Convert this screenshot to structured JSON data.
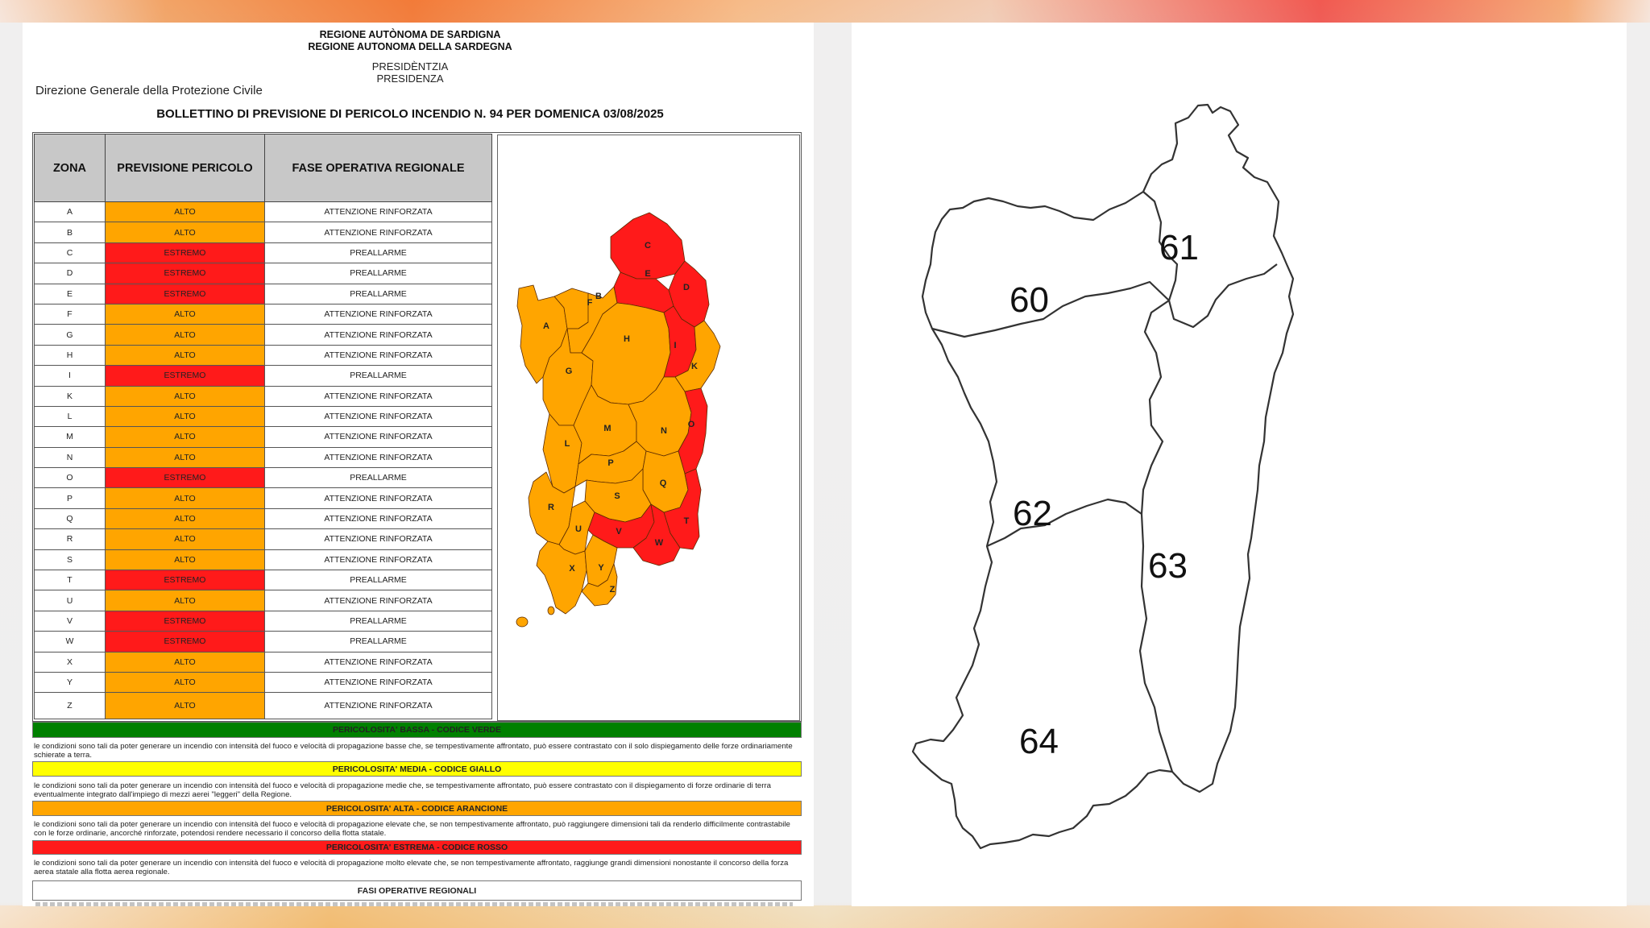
{
  "header": {
    "region_sardinian": "REGIONE AUTÒNOMA DE SARDIGNA",
    "region_italian": "REGIONE AUTONOMA DELLA SARDEGNA",
    "presidency_sardinian": "PRESIDÈNTZIA",
    "presidency_italian": "PRESIDENZA",
    "direction": "Direzione Generale della Protezione Civile",
    "title": "BOLLETTINO DI PREVISIONE DI PERICOLO INCENDIO N. 94 PER DOMENICA 03/08/2025"
  },
  "table": {
    "headers": [
      "ZONA",
      "PREVISIONE PERICOLO",
      "FASE OPERATIVA REGIONALE"
    ],
    "rows": [
      {
        "zona": "A",
        "pericolo": "ALTO",
        "fase": "ATTENZIONE RINFORZATA"
      },
      {
        "zona": "B",
        "pericolo": "ALTO",
        "fase": "ATTENZIONE RINFORZATA"
      },
      {
        "zona": "C",
        "pericolo": "ESTREMO",
        "fase": "PREALLARME"
      },
      {
        "zona": "D",
        "pericolo": "ESTREMO",
        "fase": "PREALLARME"
      },
      {
        "zona": "E",
        "pericolo": "ESTREMO",
        "fase": "PREALLARME"
      },
      {
        "zona": "F",
        "pericolo": "ALTO",
        "fase": "ATTENZIONE RINFORZATA"
      },
      {
        "zona": "G",
        "pericolo": "ALTO",
        "fase": "ATTENZIONE RINFORZATA"
      },
      {
        "zona": "H",
        "pericolo": "ALTO",
        "fase": "ATTENZIONE RINFORZATA"
      },
      {
        "zona": "I",
        "pericolo": "ESTREMO",
        "fase": "PREALLARME"
      },
      {
        "zona": "K",
        "pericolo": "ALTO",
        "fase": "ATTENZIONE RINFORZATA"
      },
      {
        "zona": "L",
        "pericolo": "ALTO",
        "fase": "ATTENZIONE RINFORZATA"
      },
      {
        "zona": "M",
        "pericolo": "ALTO",
        "fase": "ATTENZIONE RINFORZATA"
      },
      {
        "zona": "N",
        "pericolo": "ALTO",
        "fase": "ATTENZIONE RINFORZATA"
      },
      {
        "zona": "O",
        "pericolo": "ESTREMO",
        "fase": "PREALLARME"
      },
      {
        "zona": "P",
        "pericolo": "ALTO",
        "fase": "ATTENZIONE RINFORZATA"
      },
      {
        "zona": "Q",
        "pericolo": "ALTO",
        "fase": "ATTENZIONE RINFORZATA"
      },
      {
        "zona": "R",
        "pericolo": "ALTO",
        "fase": "ATTENZIONE RINFORZATA"
      },
      {
        "zona": "S",
        "pericolo": "ALTO",
        "fase": "ATTENZIONE RINFORZATA"
      },
      {
        "zona": "T",
        "pericolo": "ESTREMO",
        "fase": "PREALLARME"
      },
      {
        "zona": "U",
        "pericolo": "ALTO",
        "fase": "ATTENZIONE RINFORZATA"
      },
      {
        "zona": "V",
        "pericolo": "ESTREMO",
        "fase": "PREALLARME"
      },
      {
        "zona": "W",
        "pericolo": "ESTREMO",
        "fase": "PREALLARME"
      },
      {
        "zona": "X",
        "pericolo": "ALTO",
        "fase": "ATTENZIONE RINFORZATA"
      },
      {
        "zona": "Y",
        "pericolo": "ALTO",
        "fase": "ATTENZIONE RINFORZATA"
      },
      {
        "zona": "Z",
        "pericolo": "ALTO",
        "fase": "ATTENZIONE RINFORZATA"
      }
    ]
  },
  "colors": {
    "alto": "#ffa500",
    "estremo": "#ff1a1a",
    "verde": "#008000",
    "giallo": "#ffff00",
    "arancione": "#ffa500",
    "rosso": "#ff1a1a"
  },
  "legend": [
    {
      "title": "PERICOLOSITA' BASSA - CODICE VERDE",
      "text": "le condizioni sono tali da poter generare un incendio con intensità del fuoco e velocità di propagazione basse che, se tempestivamente affrontato, può essere contrastato con il solo dispiegamento delle forze ordinariamente schierate a terra."
    },
    {
      "title": "PERICOLOSITA' MEDIA - CODICE GIALLO",
      "text": "le condizioni sono tali da poter generare un incendio con intensità del fuoco e velocità di propagazione medie che, se tempestivamente affrontato, può essere contrastato con il dispiegamento di forze ordinarie di terra eventualmente integrato dall'impiego di mezzi aerei \"leggeri\" della Regione."
    },
    {
      "title": "PERICOLOSITA' ALTA - CODICE ARANCIONE",
      "text": "le condizioni sono tali da poter generare un incendio con intensità del fuoco e velocità di propagazione elevate che, se non tempestivamente affrontato, può raggiungere dimensioni tali da renderlo difficilmente contrastabile con le forze ordinarie, ancorché rinforzate, potendosi rendere necessario il concorso della flotta statale."
    },
    {
      "title": "PERICOLOSITA' ESTREMA - CODICE ROSSO",
      "text": "le condizioni sono tali da poter generare un incendio con intensità del fuoco e velocità di propagazione molto elevate che, se non tempestivamente affrontato, raggiunge grandi dimensioni nonostante il concorso della forza aerea statale alla flotta aerea regionale."
    }
  ],
  "fasi_title": "FASI OPERATIVE REGIONALI",
  "map_labels": {
    "A": "A",
    "B": "B",
    "C": "C",
    "D": "D",
    "E": "E",
    "F": "F",
    "G": "G",
    "H": "H",
    "I": "I",
    "K": "K",
    "L": "L",
    "M": "M",
    "N": "N",
    "O": "O",
    "P": "P",
    "Q": "Q",
    "R": "R",
    "S": "S",
    "T": "T",
    "U": "U",
    "V": "V",
    "W": "W",
    "X": "X",
    "Y": "Y",
    "Z": "Z"
  },
  "sectors": [
    "60",
    "61",
    "62",
    "63",
    "64"
  ]
}
